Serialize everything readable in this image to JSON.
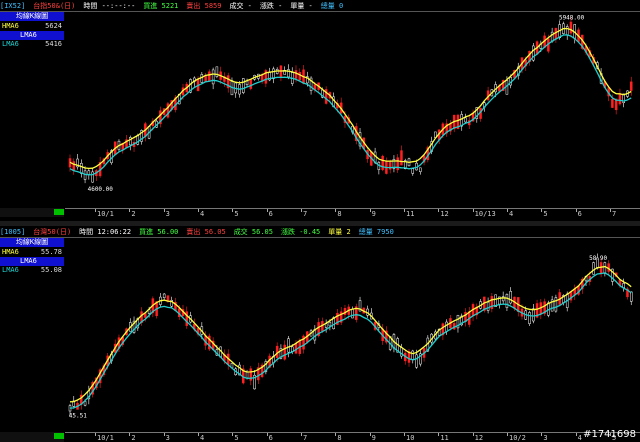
{
  "colors": {
    "background": "#000000",
    "candle_up": "#ff2020",
    "candle_down": "#ffffff",
    "hma": "#ffff40",
    "lma": "#20d0d0",
    "side_title_bg": "#1010d0",
    "status_bar": "#00c000"
  },
  "top": {
    "info": [
      {
        "text": "[IX52]",
        "color": "#40c0ff"
      },
      {
        "text": "台指50&(日)",
        "color": "#ff4040"
      },
      {
        "text": "時間 --:--:--",
        "color": "#ffffff"
      },
      {
        "text": "買進 5221",
        "color": "#40ff40"
      },
      {
        "text": "賣出 5859",
        "color": "#ff4040"
      },
      {
        "text": "成交 -",
        "color": "#ffffff"
      },
      {
        "text": "漲跌 -",
        "color": "#ffffff"
      },
      {
        "text": "單量 -",
        "color": "#ffffff"
      },
      {
        "text": "總量 0",
        "color": "#40c0ff"
      }
    ],
    "side": {
      "title": "均線K線圖",
      "rows": [
        {
          "label": "HMA6",
          "value": "5624",
          "selected": false
        },
        {
          "label": "LMA6",
          "value": "",
          "selected": true
        },
        {
          "label": "LMA6",
          "value": "5416",
          "selected": false
        }
      ]
    },
    "axis_labels": [
      "10/1",
      "2",
      "3",
      "4",
      "5",
      "6",
      "7",
      "8",
      "9",
      "11",
      "12",
      "10/13",
      "4",
      "5",
      "6",
      "7"
    ],
    "high_label": "5948.00",
    "low_label": "4600.00"
  },
  "bottom": {
    "info": [
      {
        "text": "[1005]",
        "color": "#40c0ff"
      },
      {
        "text": "台灣50(日)",
        "color": "#ff4040"
      },
      {
        "text": "時間 12:06:22",
        "color": "#ffffff"
      },
      {
        "text": "買進 56.00",
        "color": "#40ff40"
      },
      {
        "text": "賣出 56.05",
        "color": "#ff4040"
      },
      {
        "text": "成交 56.05",
        "color": "#40ff40"
      },
      {
        "text": "漲跌 -0.45",
        "color": "#40ff40"
      },
      {
        "text": "單量 2",
        "color": "#ffff40"
      },
      {
        "text": "總量 7950",
        "color": "#40c0ff"
      }
    ],
    "side": {
      "title": "均線K線圖",
      "rows": [
        {
          "label": "HMA6",
          "value": "55.78",
          "selected": false
        },
        {
          "label": "LMA6",
          "value": "",
          "selected": true
        },
        {
          "label": "LMA6",
          "value": "55.08",
          "selected": false
        }
      ]
    },
    "axis_labels": [
      "10/1",
      "2",
      "3",
      "4",
      "5",
      "6",
      "7",
      "8",
      "9",
      "10",
      "11",
      "12",
      "10/2",
      "3",
      "4",
      "5"
    ],
    "high_label": "58.90",
    "low_label": "45.51"
  },
  "watermark": "#1741698"
}
